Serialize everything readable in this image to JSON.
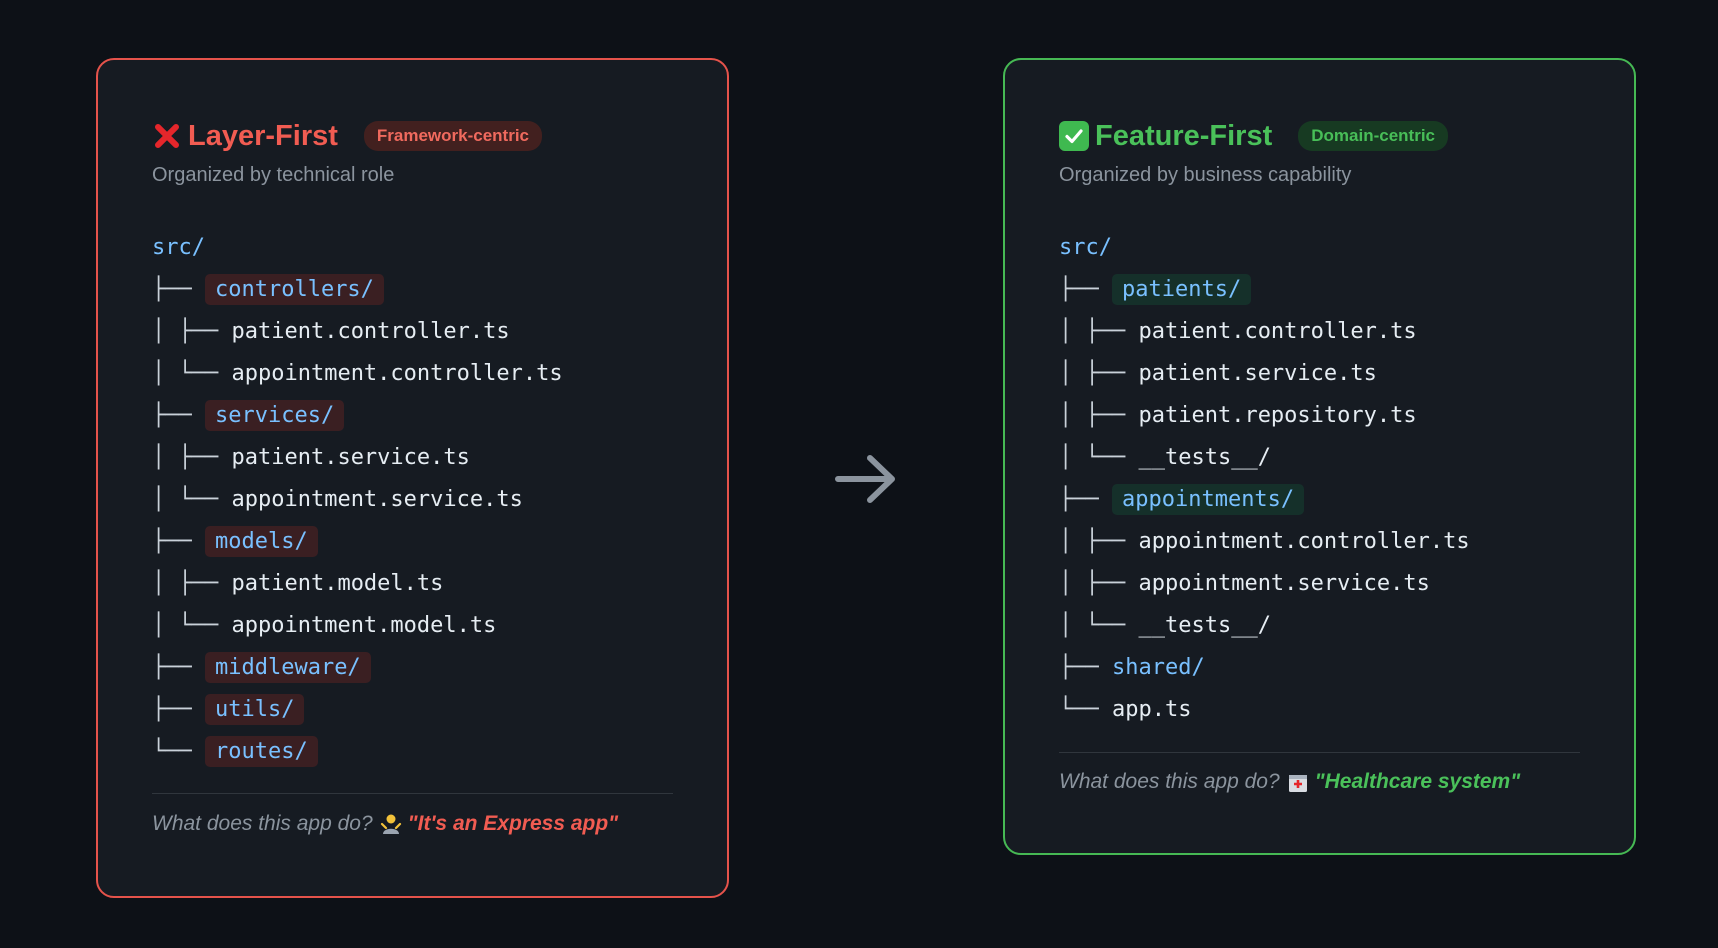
{
  "left": {
    "title": "Layer-First",
    "badge": "Framework-centric",
    "subtitle": "Organized by technical role",
    "tree": [
      {
        "prefix": "",
        "name": "src/",
        "kind": "root"
      },
      {
        "prefix": "├── ",
        "name": "controllers/",
        "kind": "folder"
      },
      {
        "prefix": "│ ├── ",
        "name": "patient.controller.ts",
        "kind": "file"
      },
      {
        "prefix": "│ └── ",
        "name": "appointment.controller.ts",
        "kind": "file"
      },
      {
        "prefix": "├── ",
        "name": "services/",
        "kind": "folder"
      },
      {
        "prefix": "│ ├── ",
        "name": "patient.service.ts",
        "kind": "file"
      },
      {
        "prefix": "│ └── ",
        "name": "appointment.service.ts",
        "kind": "file"
      },
      {
        "prefix": "├── ",
        "name": "models/",
        "kind": "folder"
      },
      {
        "prefix": "│ ├── ",
        "name": "patient.model.ts",
        "kind": "file"
      },
      {
        "prefix": "│ └── ",
        "name": "appointment.model.ts",
        "kind": "file"
      },
      {
        "prefix": "├── ",
        "name": "middleware/",
        "kind": "folder"
      },
      {
        "prefix": "├── ",
        "name": "utils/",
        "kind": "folder"
      },
      {
        "prefix": "└── ",
        "name": "routes/",
        "kind": "folder"
      }
    ],
    "question": "What does this app do?",
    "answer": "\"It's an Express app\"",
    "icon": "cross-mark-icon",
    "emoji_icon": "shrug-person-icon"
  },
  "right": {
    "title": "Feature-First",
    "badge": "Domain-centric",
    "subtitle": "Organized by business capability",
    "tree": [
      {
        "prefix": "",
        "name": "src/",
        "kind": "root"
      },
      {
        "prefix": "├── ",
        "name": "patients/",
        "kind": "folder"
      },
      {
        "prefix": "│ ├── ",
        "name": "patient.controller.ts",
        "kind": "file"
      },
      {
        "prefix": "│ ├── ",
        "name": "patient.service.ts",
        "kind": "file"
      },
      {
        "prefix": "│ ├── ",
        "name": "patient.repository.ts",
        "kind": "file"
      },
      {
        "prefix": "│ └── ",
        "name": "__tests__/",
        "kind": "file"
      },
      {
        "prefix": "├── ",
        "name": "appointments/",
        "kind": "folder"
      },
      {
        "prefix": "│ ├── ",
        "name": "appointment.controller.ts",
        "kind": "file"
      },
      {
        "prefix": "│ ├── ",
        "name": "appointment.service.ts",
        "kind": "file"
      },
      {
        "prefix": "│ └── ",
        "name": "__tests__/",
        "kind": "file"
      },
      {
        "prefix": "├── ",
        "name": "shared/",
        "kind": "plainfolder"
      },
      {
        "prefix": "└── ",
        "name": "app.ts",
        "kind": "file"
      }
    ],
    "question": "What does this app do?",
    "answer": "\"Healthcare system\"",
    "icon": "check-mark-icon",
    "emoji_icon": "hospital-icon"
  },
  "arrow_icon": "right-arrow-icon",
  "colors": {
    "background": "#0d1117",
    "card": "#161b22",
    "red_accent": "#e5534b",
    "green_accent": "#46b954",
    "folder_text": "#79c0ff",
    "muted_text": "#8b949e"
  }
}
